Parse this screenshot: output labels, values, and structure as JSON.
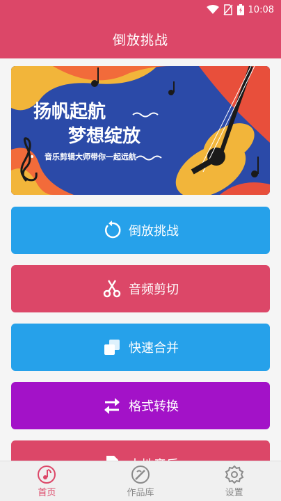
{
  "status": {
    "time": "10:08"
  },
  "appbar": {
    "title": "倒放挑战"
  },
  "banner": {
    "line1": "扬帆起航",
    "line2": "梦想绽放",
    "subtitle": "音乐剪辑大师带你一起远航"
  },
  "buttons": [
    {
      "label": "倒放挑战",
      "color": "#26a1ea",
      "icon": "reverse-icon"
    },
    {
      "label": "音频剪切",
      "color": "#dc4768",
      "icon": "scissors-icon"
    },
    {
      "label": "快速合并",
      "color": "#26a1ea",
      "icon": "merge-icon"
    },
    {
      "label": "格式转换",
      "color": "#a312c8",
      "icon": "convert-icon"
    },
    {
      "label": "本地音乐",
      "color": "#dc4768",
      "icon": "music-file-icon"
    }
  ],
  "nav": {
    "items": [
      {
        "label": "首页",
        "icon": "home-music-icon"
      },
      {
        "label": "作品库",
        "icon": "works-icon"
      },
      {
        "label": "设置",
        "icon": "settings-icon"
      }
    ]
  }
}
